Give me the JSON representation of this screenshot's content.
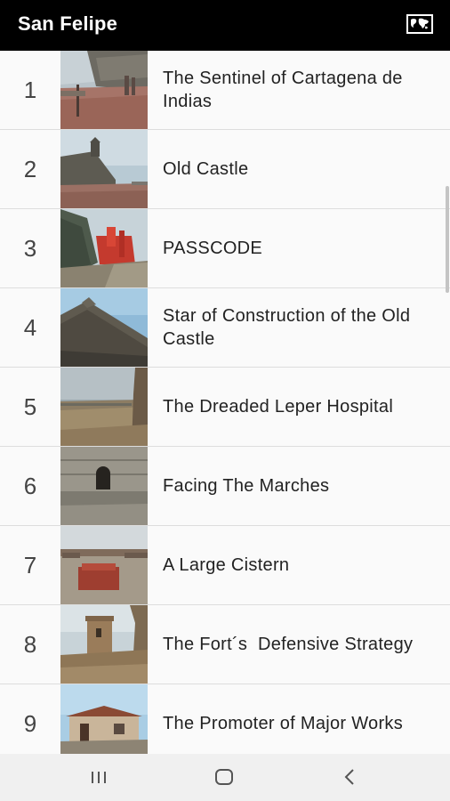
{
  "app_bar": {
    "title": "San Felipe",
    "map_icon": "world-map-icon"
  },
  "items": [
    {
      "number": "1",
      "title": "The Sentinel of Cartagena de Indias"
    },
    {
      "number": "2",
      "title": "Old Castle"
    },
    {
      "number": "3",
      "title": "PASSCODE"
    },
    {
      "number": "4",
      "title": "Star of Construction of the Old Castle"
    },
    {
      "number": "5",
      "title": "The Dreaded Leper Hospital"
    },
    {
      "number": "6",
      "title": "Facing The Marches"
    },
    {
      "number": "7",
      "title": "A Large Cistern"
    },
    {
      "number": "8",
      "title": "The Fort´s  Defensive Strategy"
    },
    {
      "number": "9",
      "title": "The Promoter of Major Works"
    }
  ],
  "nav_bar": {
    "recents_icon": "recents-icon",
    "home_icon": "home-icon",
    "back_icon": "back-icon"
  }
}
